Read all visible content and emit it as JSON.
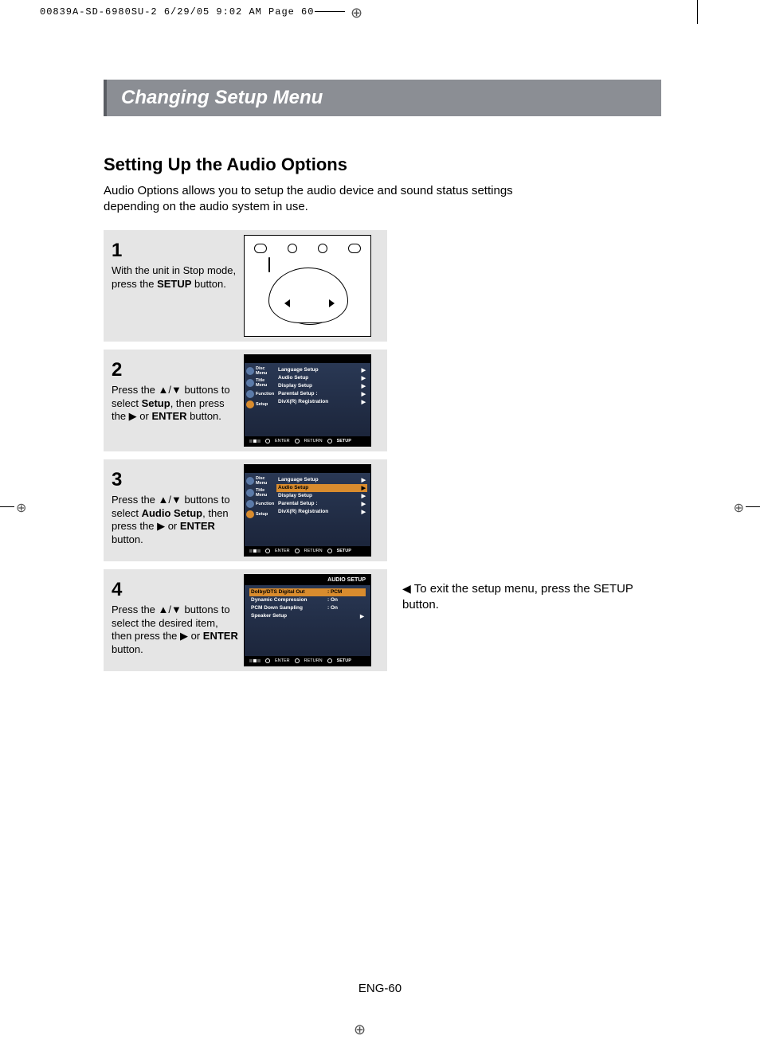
{
  "crop_header": "00839A-SD-6980SU-2  6/29/05  9:02 AM  Page 60",
  "title_bar": "Changing Setup Menu",
  "section_title": "Setting Up the Audio Options",
  "section_intro": "Audio Options allows you to setup the audio device and sound status settings depending on the audio system in use.",
  "steps": {
    "s1": {
      "num": "1",
      "text_a": "With the unit in Stop mode, press the ",
      "bold": "SETUP",
      "text_b": " button."
    },
    "s2": {
      "num": "2",
      "text_a": "Press the ▲/▼ buttons to select ",
      "bold1": "Setup",
      "text_b": ", then press the ▶ or ",
      "bold2": "ENTER",
      "text_c": " button."
    },
    "s3": {
      "num": "3",
      "text_a": "Press the ▲/▼ buttons to select ",
      "bold1": "Audio Setup",
      "text_b": ", then press the ▶ or ",
      "bold2": "ENTER",
      "text_c": " button."
    },
    "s4": {
      "num": "4",
      "text_a": "Press the ▲/▼ buttons to select the desired item, then press the ▶ or ",
      "bold": "ENTER",
      "text_b": " button."
    }
  },
  "osd_side": {
    "items": [
      "Disc Menu",
      "Title Menu",
      "Function",
      "Setup"
    ]
  },
  "osd_menu": {
    "rows": [
      "Language Setup",
      "Audio Setup",
      "Display Setup",
      "Parental Setup :",
      "DivX(R) Registration"
    ]
  },
  "osd_stat": {
    "enter": "ENTER",
    "return": "RETURN",
    "setup": "SETUP"
  },
  "osd2": {
    "title": "AUDIO SETUP",
    "rows": [
      {
        "label": "Dolby/DTS Digital Out",
        "val": ": PCM",
        "hl": true
      },
      {
        "label": "Dynamic Compression",
        "val": ": On"
      },
      {
        "label": "PCM Down Sampling",
        "val": ": On"
      },
      {
        "label": "Speaker Setup",
        "val": "▶"
      }
    ]
  },
  "exit_note": "To exit the setup menu, press the SETUP button.",
  "page_num": "ENG-60"
}
